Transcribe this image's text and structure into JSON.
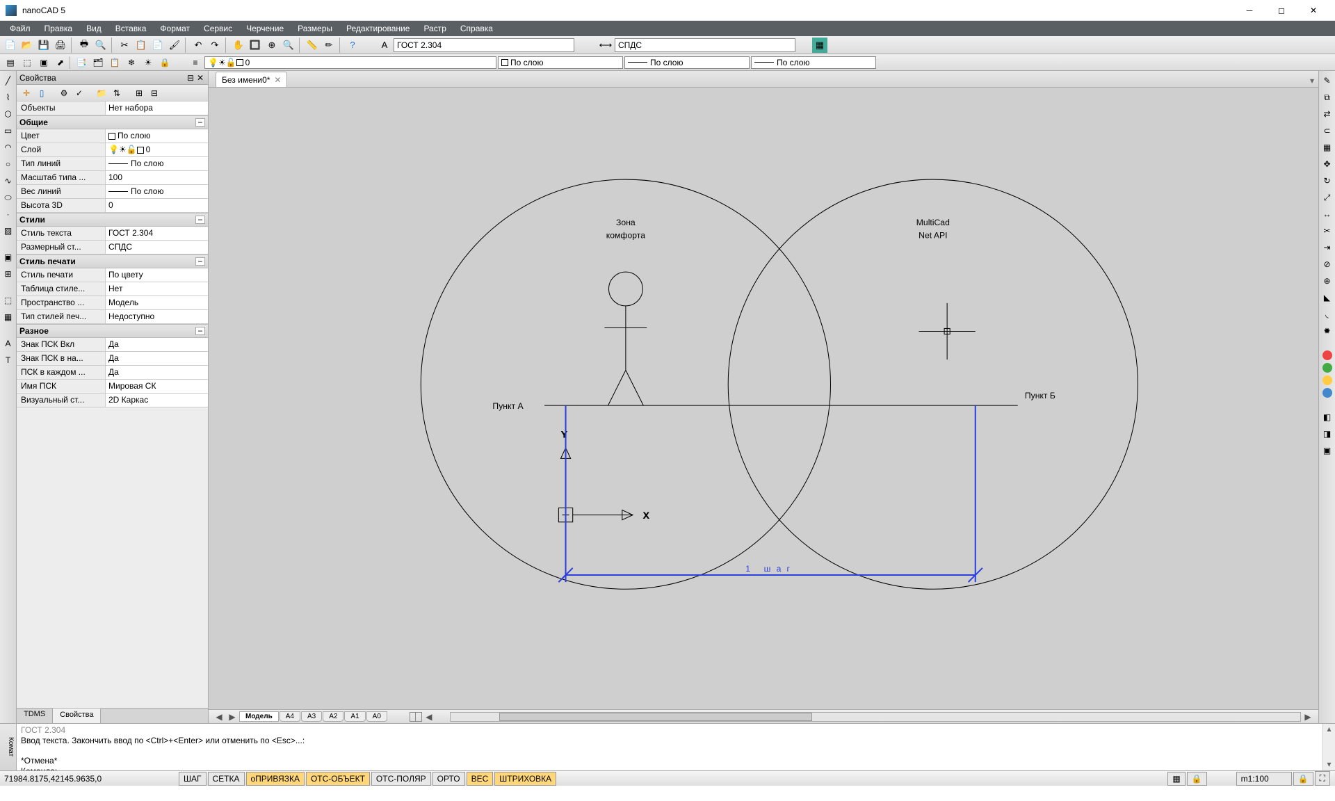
{
  "title": "nanoCAD 5",
  "menu": [
    "Файл",
    "Правка",
    "Вид",
    "Вставка",
    "Формат",
    "Сервис",
    "Черчение",
    "Размеры",
    "Редактирование",
    "Растр",
    "Справка"
  ],
  "combo_style": "ГОСТ 2.304",
  "combo_dim": "СПДС",
  "layer_name": "0",
  "bylayer": "По слою",
  "doc_tab": "Без имени0*",
  "prop_panel": {
    "title": "Свойства",
    "objects_label": "Объекты",
    "objects_val": "Нет набора",
    "cats": {
      "general": "Общие",
      "styles": "Стили",
      "plotstyle": "Стиль печати",
      "misc": "Разное"
    },
    "rows": {
      "color": [
        "Цвет",
        "По слою"
      ],
      "layer": [
        "Слой",
        "0"
      ],
      "ltype": [
        "Тип линий",
        "По слою"
      ],
      "ltscale": [
        "Масштаб типа ...",
        "100"
      ],
      "lweight": [
        "Вес линий",
        "По слою"
      ],
      "height3d": [
        "Высота 3D",
        "0"
      ],
      "tstyle": [
        "Стиль текста",
        "ГОСТ 2.304"
      ],
      "dstyle": [
        "Размерный ст...",
        "СПДС"
      ],
      "pstyle": [
        "Стиль печати",
        "По цвету"
      ],
      "ptable": [
        "Таблица стиле...",
        "Нет"
      ],
      "pspace": [
        "Пространство ...",
        "Модель"
      ],
      "pstype": [
        "Тип стилей печ...",
        "Недоступно"
      ],
      "ucsicon": [
        "Знак ПСК Вкл",
        "Да"
      ],
      "ucsorigin": [
        "Знак ПСК в на...",
        "Да"
      ],
      "ucsineach": [
        "ПСК в каждом ...",
        "Да"
      ],
      "ucsname": [
        "Имя ПСК",
        "Мировая СК"
      ],
      "vstyle": [
        "Визуальный ст...",
        "2D Каркас"
      ]
    },
    "tabs": [
      "TDMS",
      "Свойства"
    ]
  },
  "drawing": {
    "zone": "Зона\nкомфорта",
    "api": "MultiCad\nNet API",
    "pointA": "Пункт А",
    "pointB": "Пункт Б",
    "step": "1 шаг"
  },
  "model_tabs": [
    "Модель",
    "A4",
    "A3",
    "A2",
    "A1",
    "A0"
  ],
  "cmd": {
    "line1": "ГОСТ 2.304",
    "line2": "Ввод текста. Закончить ввод по <Ctrl>+<Enter> или отменить по <Esc>...:",
    "line3": "",
    "line4": "*Отмена*",
    "line5": "Команда:"
  },
  "status": {
    "coords": "71984.8175,42145.9635,0",
    "buttons": [
      "ШАГ",
      "СЕТКА",
      "оПРИВЯЗКА",
      "ОТС-ОБЪЕКТ",
      "ОТС-ПОЛЯР",
      "ОРТО",
      "ВЕС",
      "ШТРИХОВКА"
    ],
    "scale": "m1:100"
  }
}
